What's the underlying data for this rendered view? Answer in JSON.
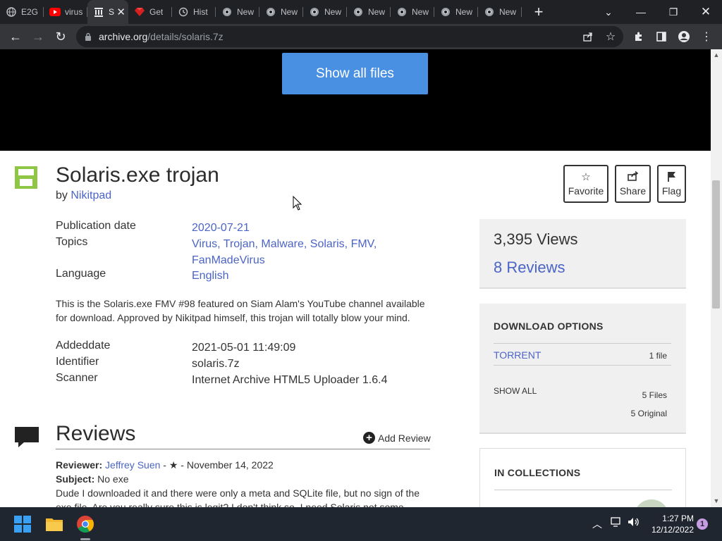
{
  "browser": {
    "tabs": [
      {
        "label": "E2G",
        "icon": "globe-icon"
      },
      {
        "label": "virus",
        "icon": "youtube-icon"
      },
      {
        "label": "S",
        "icon": "archive-icon",
        "active": true
      },
      {
        "label": "Get",
        "icon": "ruby-icon"
      },
      {
        "label": "Hist",
        "icon": "history-icon"
      },
      {
        "label": "New",
        "icon": "chrome-icon"
      },
      {
        "label": "New",
        "icon": "chrome-icon"
      },
      {
        "label": "New",
        "icon": "chrome-icon"
      },
      {
        "label": "New",
        "icon": "chrome-icon"
      },
      {
        "label": "New",
        "icon": "chrome-icon"
      },
      {
        "label": "New",
        "icon": "chrome-icon"
      },
      {
        "label": "New",
        "icon": "chrome-icon"
      }
    ],
    "url_host": "archive.org",
    "url_path": "/details/solaris.7z"
  },
  "page": {
    "show_all_files": "Show all files",
    "title": "Solaris.exe trojan",
    "by_prefix": "by",
    "author": "Nikitpad",
    "metadata": [
      {
        "key": "Publication date",
        "value": "2020-07-21",
        "link": true
      },
      {
        "key": "Topics",
        "value": "Virus, Trojan, Malware, Solaris, FMV,",
        "value2": "FanMadeVirus",
        "link": true
      },
      {
        "key": "Language",
        "value": "English",
        "link": true
      }
    ],
    "description_line1": "This is the Solaris.exe FMV #98 featured on Siam Alam's YouTube channel available",
    "description_line2": "for download. Approved by Nikitpad himself, this trojan will totally blow your mind.",
    "extra_metadata": [
      {
        "key": "Addeddate",
        "value": "2021-05-01 11:49:09"
      },
      {
        "key": "Identifier",
        "value": "solaris.7z"
      },
      {
        "key": "Scanner",
        "value": "Internet Archive HTML5 Uploader 1.6.4"
      }
    ],
    "actions": {
      "favorite": "Favorite",
      "share": "Share",
      "flag": "Flag"
    },
    "stats": {
      "views": "3,395 Views",
      "reviews": "8 Reviews"
    },
    "download": {
      "heading": "DOWNLOAD OPTIONS",
      "torrent": "TORRENT",
      "torrent_count": "1 file",
      "show_all": "SHOW ALL",
      "files": "5 Files",
      "original": "5 Original"
    },
    "collections": {
      "heading": "IN COLLECTIONS"
    },
    "reviews": {
      "heading": "Reviews",
      "add_review": "Add Review",
      "reviewer_label": "Reviewer:",
      "reviewer": "Jeffrey Suen",
      "rating_and_date": " - ★ - November 14, 2022",
      "subject_label": "Subject:",
      "subject": "No exe",
      "body_line1": "Dude I downloaded it and there were only a meta and SQLite file, but no sign of the",
      "body_line2": "exe file. Are you really sure this is legit? I don't think so. I need Solaris not some"
    }
  },
  "taskbar": {
    "time": "1:27 PM",
    "date": "12/12/2022",
    "notification_count": "1"
  },
  "colors": {
    "accent_blue": "#4a90e2",
    "link": "#4b64c8",
    "item_icon_green": "#8fc646"
  }
}
